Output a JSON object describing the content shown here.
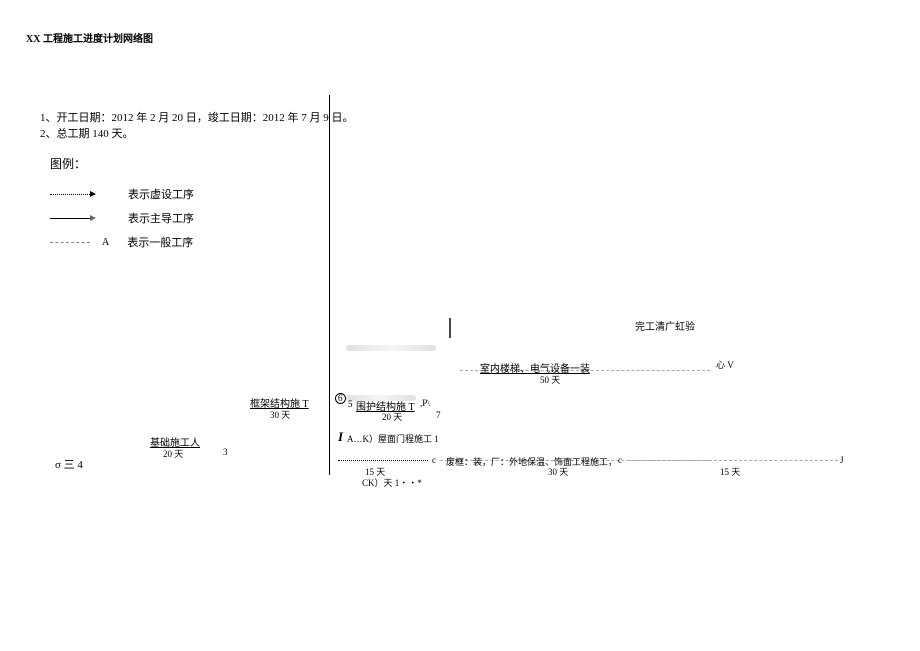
{
  "title": "XX 工程施工进度计划网络图",
  "info_line1": "1、开工日期：2012 年 2 月 20 日，竣工日期：2012 年 7 月 9 日。",
  "info_line2": "2、总工期 140 天。",
  "legend": {
    "title": "图例：",
    "items": [
      {
        "label": "表示虚设工序"
      },
      {
        "label": "表示主导工序"
      },
      {
        "label": "表示一般工序"
      }
    ],
    "dashed_suffix": "A"
  },
  "misc": {
    "sigma": "σ 三 4",
    "node6": "6",
    "node5": "5",
    "node7": "7",
    "letterI": "I",
    "letterP": ",P\\",
    "heartV": "心\nV",
    "letterJ": "J",
    "letterC_start": "c",
    "letterC_end": "c"
  },
  "tasks": {
    "foundation": {
      "name": "基础施工人",
      "dur": "20 天",
      "right": "3"
    },
    "frame": {
      "name": "框架结构施 T",
      "dur": "30 天"
    },
    "envelope": {
      "name": "围护结构施 T",
      "dur": "20 天"
    },
    "roof": {
      "name": "A…K）屋面门程施工 1"
    },
    "indoor": {
      "name": "室内楼梯、电气设备一装",
      "dur": "50 天"
    },
    "bottom_left": {
      "dur15": "15 天",
      "ck": "CK）天 1・・*"
    },
    "bottom_mid": {
      "name": "废框：装，厂：外地保温、饰面工程施工，",
      "dur": "30 天"
    },
    "bottom_right": {
      "dur15": "15 天"
    },
    "final": {
      "name": "完工清广虹验"
    }
  }
}
